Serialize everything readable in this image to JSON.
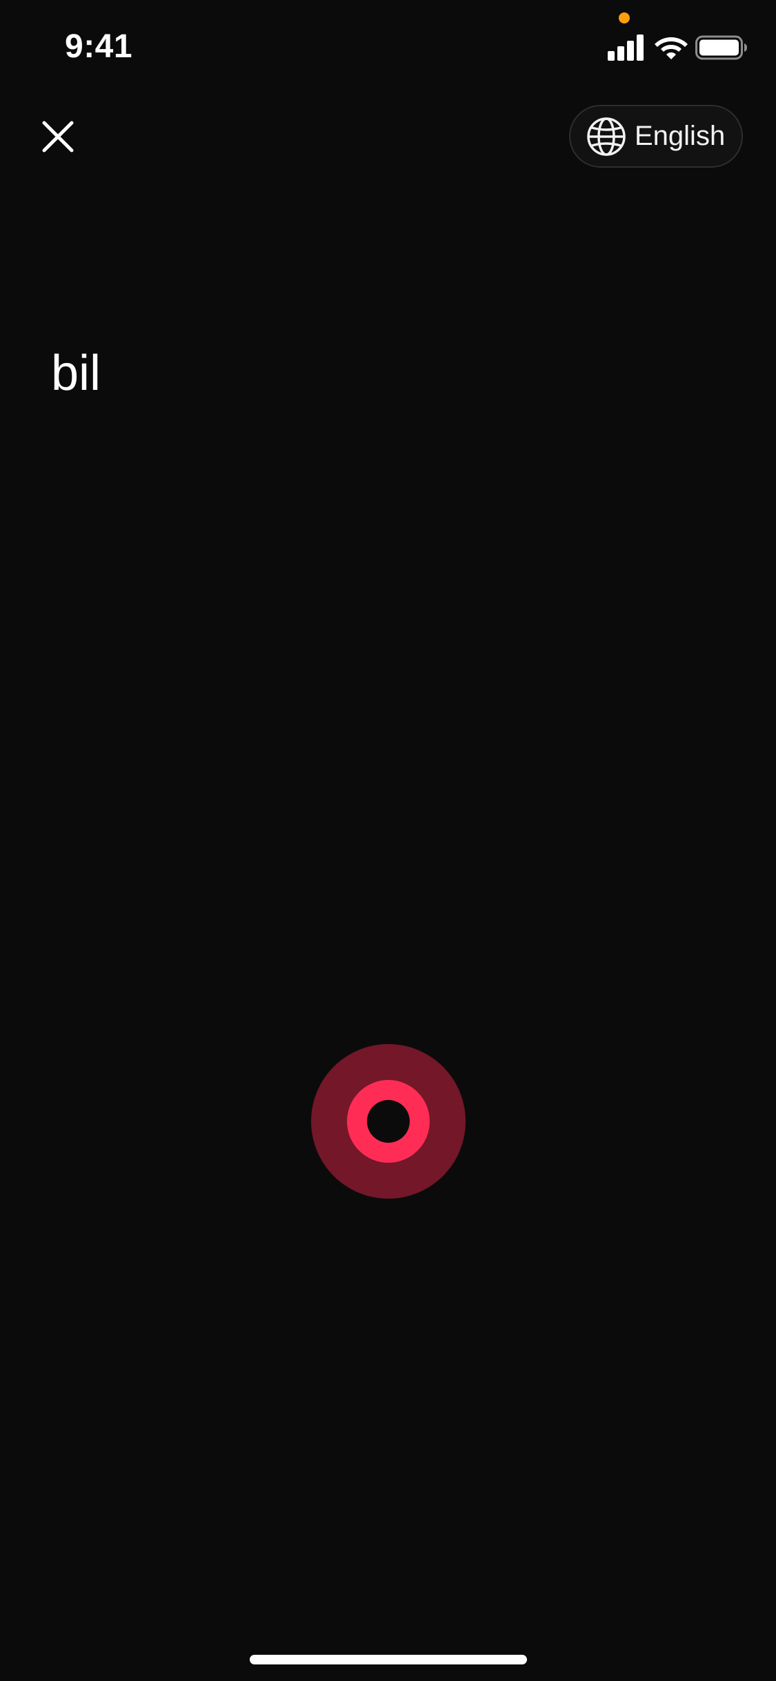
{
  "status_bar": {
    "time": "9:41",
    "signal_icon": "cellular-signal-icon",
    "wifi_icon": "wifi-icon",
    "battery_icon": "battery-full-icon",
    "privacy_indicator_color": "#ff9f0a"
  },
  "header": {
    "close_icon": "close-icon",
    "language": {
      "icon": "globe-icon",
      "label": "English"
    }
  },
  "transcript": {
    "text": "bil"
  },
  "record_button": {
    "icon": "record-icon",
    "outer_color": "#731729",
    "ring_color": "#ff2d55",
    "core_color": "#0b0b0b"
  },
  "colors": {
    "background": "#0b0b0b",
    "text": "#ffffff"
  }
}
